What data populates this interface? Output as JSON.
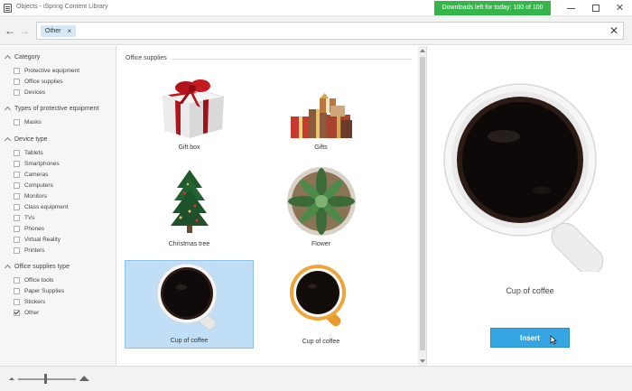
{
  "window": {
    "title": "Objects - iSpring Content Library",
    "downloads_badge": "Downloads left for today: 100 of 100",
    "icons": [
      "app-icon",
      "minimize-icon",
      "maximize-icon",
      "close-icon"
    ]
  },
  "search": {
    "chip_label": "Other",
    "icons": [
      "back-arrow-icon",
      "forward-arrow-icon",
      "chip-remove-icon",
      "clear-search-icon"
    ]
  },
  "sidebar": {
    "groups": [
      {
        "title": "Category",
        "items": [
          {
            "label": "Protective equipment",
            "checked": false
          },
          {
            "label": "Office supplies",
            "checked": false
          },
          {
            "label": "Devices",
            "checked": false
          }
        ]
      },
      {
        "title": "Types of protective equipment",
        "items": [
          {
            "label": "Masks",
            "checked": false
          }
        ]
      },
      {
        "title": "Device type",
        "items": [
          {
            "label": "Tablets",
            "checked": false
          },
          {
            "label": "Smartphones",
            "checked": false
          },
          {
            "label": "Cameras",
            "checked": false
          },
          {
            "label": "Computers",
            "checked": false
          },
          {
            "label": "Monitors",
            "checked": false
          },
          {
            "label": "Class equipment",
            "checked": false
          },
          {
            "label": "TVs",
            "checked": false
          },
          {
            "label": "Phones",
            "checked": false
          },
          {
            "label": "Virtual Reality",
            "checked": false
          },
          {
            "label": "Printers",
            "checked": false
          }
        ]
      },
      {
        "title": "Office supplies type",
        "items": [
          {
            "label": "Office tools",
            "checked": false
          },
          {
            "label": "Paper Supplies",
            "checked": false
          },
          {
            "label": "Stickers",
            "checked": false
          },
          {
            "label": "Other",
            "checked": true
          }
        ]
      }
    ]
  },
  "content": {
    "section_title": "Office supplies",
    "items": [
      {
        "label": "Gift box",
        "selected": false,
        "icon": "gift-box-icon"
      },
      {
        "label": "Gifts",
        "selected": false,
        "icon": "gifts-icon"
      },
      {
        "label": "Christmas tree",
        "selected": false,
        "icon": "christmas-tree-icon"
      },
      {
        "label": "Flower",
        "selected": false,
        "icon": "flower-icon"
      },
      {
        "label": "Cup of coffee",
        "selected": true,
        "icon": "white-coffee-cup-icon"
      },
      {
        "label": "Cup of coffee",
        "selected": false,
        "icon": "orange-coffee-cup-icon"
      }
    ]
  },
  "preview": {
    "title": "Cup of coffee",
    "insert_label": "Insert"
  },
  "zoom": {
    "level": 0.47,
    "icons": [
      "zoom-out-icon",
      "zoom-in-icon"
    ]
  },
  "colors": {
    "accent": "#36a6e2",
    "badge": "#36b54a",
    "selection": "#c0dff7"
  }
}
